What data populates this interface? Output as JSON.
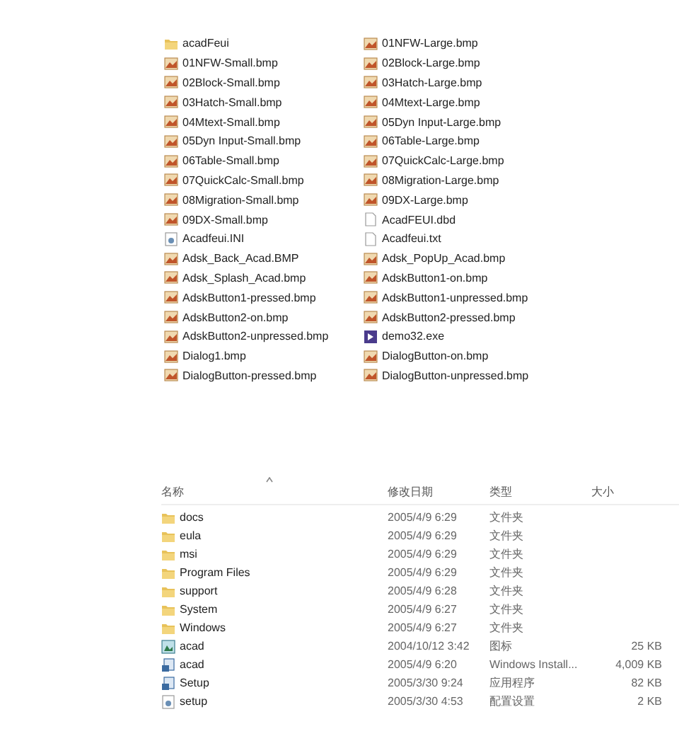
{
  "icon_view": {
    "columns": [
      [
        {
          "name": "acadFeui",
          "kind": "folder"
        },
        {
          "name": "01NFW-Small.bmp",
          "kind": "bitmap"
        },
        {
          "name": "02Block-Small.bmp",
          "kind": "bitmap"
        },
        {
          "name": "03Hatch-Small.bmp",
          "kind": "bitmap"
        },
        {
          "name": "04Mtext-Small.bmp",
          "kind": "bitmap"
        },
        {
          "name": "05Dyn Input-Small.bmp",
          "kind": "bitmap"
        },
        {
          "name": "06Table-Small.bmp",
          "kind": "bitmap"
        },
        {
          "name": "07QuickCalc-Small.bmp",
          "kind": "bitmap"
        },
        {
          "name": "08Migration-Small.bmp",
          "kind": "bitmap"
        },
        {
          "name": "09DX-Small.bmp",
          "kind": "bitmap"
        },
        {
          "name": "Acadfeui.INI",
          "kind": "settings"
        },
        {
          "name": "Adsk_Back_Acad.BMP",
          "kind": "bitmap"
        },
        {
          "name": "Adsk_Splash_Acad.bmp",
          "kind": "bitmap"
        },
        {
          "name": "AdskButton1-pressed.bmp",
          "kind": "bitmap"
        },
        {
          "name": "AdskButton2-on.bmp",
          "kind": "bitmap"
        },
        {
          "name": "AdskButton2-unpressed.bmp",
          "kind": "bitmap"
        },
        {
          "name": "Dialog1.bmp",
          "kind": "bitmap"
        },
        {
          "name": "DialogButton-pressed.bmp",
          "kind": "bitmap"
        }
      ],
      [
        {
          "name": "01NFW-Large.bmp",
          "kind": "bitmap"
        },
        {
          "name": "02Block-Large.bmp",
          "kind": "bitmap"
        },
        {
          "name": "03Hatch-Large.bmp",
          "kind": "bitmap"
        },
        {
          "name": "04Mtext-Large.bmp",
          "kind": "bitmap"
        },
        {
          "name": "05Dyn Input-Large.bmp",
          "kind": "bitmap"
        },
        {
          "name": "06Table-Large.bmp",
          "kind": "bitmap"
        },
        {
          "name": "07QuickCalc-Large.bmp",
          "kind": "bitmap"
        },
        {
          "name": "08Migration-Large.bmp",
          "kind": "bitmap"
        },
        {
          "name": "09DX-Large.bmp",
          "kind": "bitmap"
        },
        {
          "name": "AcadFEUI.dbd",
          "kind": "file"
        },
        {
          "name": "Acadfeui.txt",
          "kind": "file"
        },
        {
          "name": "Adsk_PopUp_Acad.bmp",
          "kind": "bitmap"
        },
        {
          "name": "AdskButton1-on.bmp",
          "kind": "bitmap"
        },
        {
          "name": "AdskButton1-unpressed.bmp",
          "kind": "bitmap"
        },
        {
          "name": "AdskButton2-pressed.bmp",
          "kind": "bitmap"
        },
        {
          "name": "demo32.exe",
          "kind": "program"
        },
        {
          "name": "DialogButton-on.bmp",
          "kind": "bitmap"
        },
        {
          "name": "DialogButton-unpressed.bmp",
          "kind": "bitmap"
        }
      ]
    ]
  },
  "details_view": {
    "headers": [
      "名称",
      "修改日期",
      "类型",
      "大小"
    ],
    "rows": [
      {
        "name": "docs",
        "kind": "folder",
        "modified": "2005/4/9 6:29",
        "type": "文件夹"
      },
      {
        "name": "eula",
        "kind": "folder",
        "modified": "2005/4/9 6:29",
        "type": "文件夹"
      },
      {
        "name": "msi",
        "kind": "folder",
        "modified": "2005/4/9 6:29",
        "type": "文件夹"
      },
      {
        "name": "Program Files",
        "kind": "folder",
        "modified": "2005/4/9 6:29",
        "type": "文件夹"
      },
      {
        "name": "support",
        "kind": "folder",
        "modified": "2005/4/9 6:28",
        "type": "文件夹"
      },
      {
        "name": "System",
        "kind": "folder",
        "modified": "2005/4/9 6:27",
        "type": "文件夹"
      },
      {
        "name": "Windows",
        "kind": "folder",
        "modified": "2005/4/9 6:27",
        "type": "文件夹"
      },
      {
        "name": "acad",
        "kind": "icon",
        "modified": "2004/10/12 3:42",
        "type": "图标",
        "size": "25 KB"
      },
      {
        "name": "acad",
        "kind": "installer",
        "modified": "2005/4/9 6:20",
        "type": "Windows Install...",
        "size": "4,009 KB"
      },
      {
        "name": "Setup",
        "kind": "installer",
        "modified": "2005/3/30 9:24",
        "type": "应用程序",
        "size": "82 KB"
      },
      {
        "name": "setup",
        "kind": "settings",
        "modified": "2005/3/30 4:53",
        "type": "配置设置",
        "size": "2 KB"
      }
    ]
  }
}
